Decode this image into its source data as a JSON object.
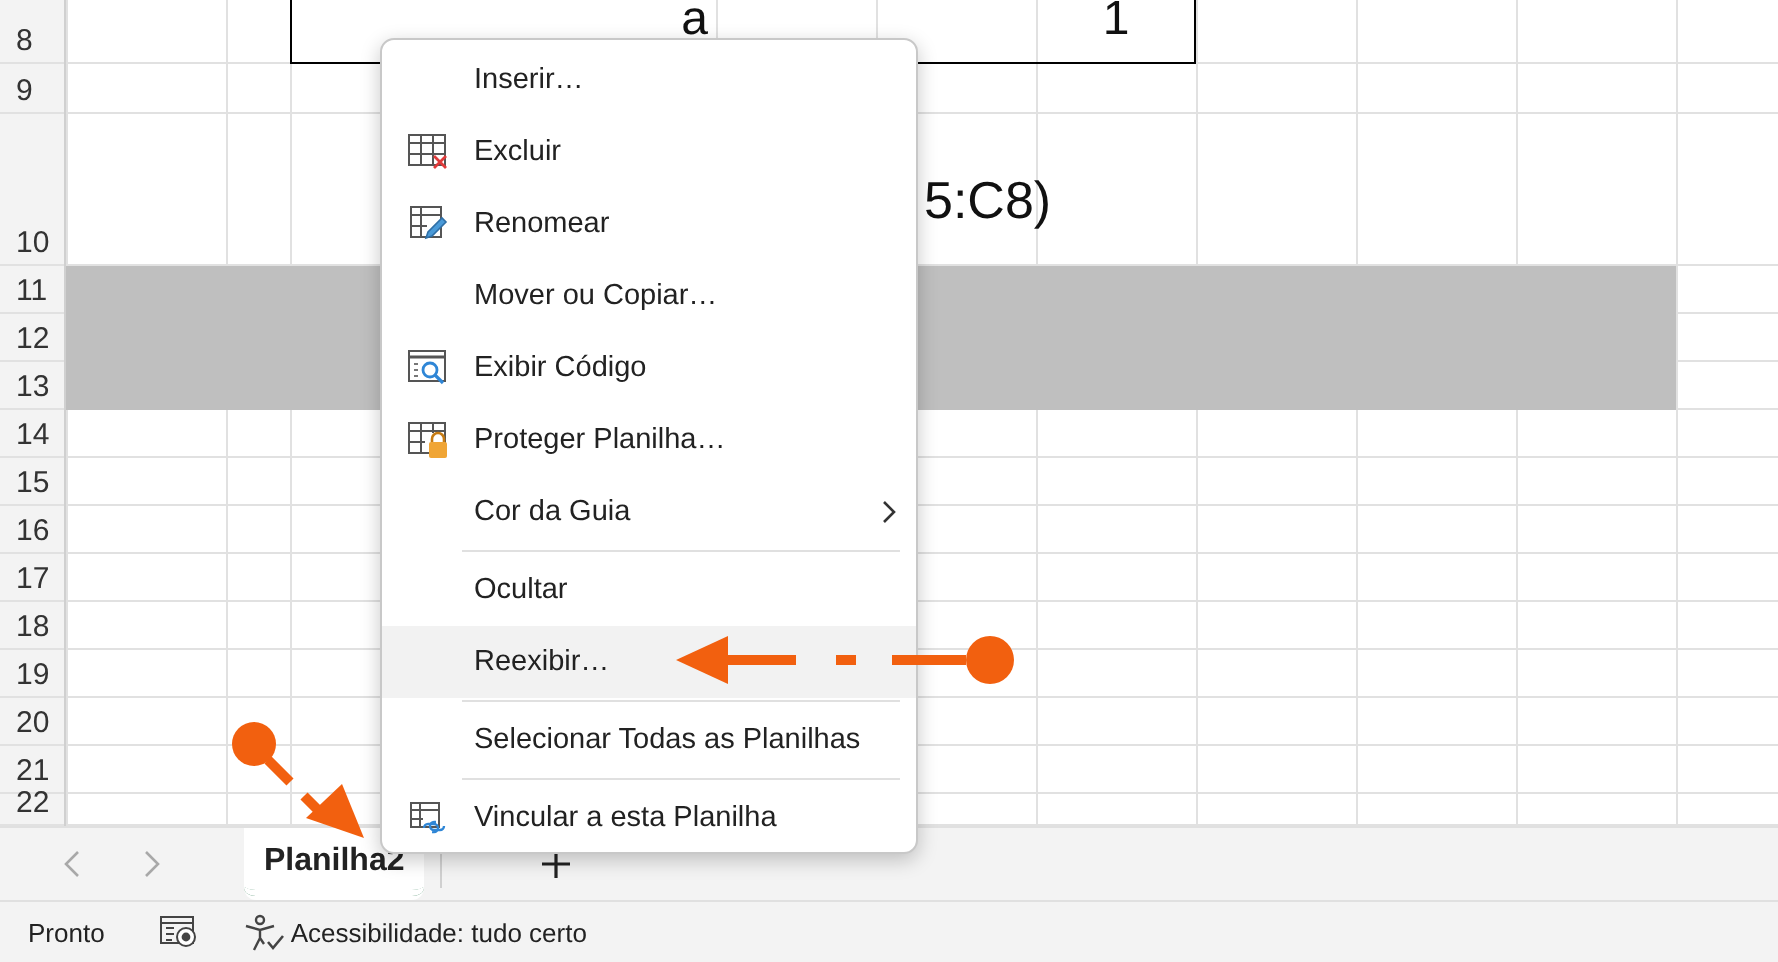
{
  "sheet": {
    "rows": [
      {
        "header": "8",
        "boxed": true,
        "shaded": false,
        "cells": {
          "column_3": "a",
          "column_6": "1"
        }
      },
      {
        "header": "9",
        "boxed": false,
        "shaded": false
      },
      {
        "header": "10",
        "boxed": false,
        "shaded": false,
        "cells": {
          "column_5": "5:C8)"
        }
      },
      {
        "header": "11",
        "boxed": false,
        "shaded": true
      },
      {
        "header": "12",
        "boxed": false,
        "shaded": true
      },
      {
        "header": "13",
        "boxed": false,
        "shaded": true
      },
      {
        "header": "14",
        "boxed": false,
        "shaded": false
      },
      {
        "header": "15",
        "boxed": false,
        "shaded": false
      },
      {
        "header": "16",
        "boxed": false,
        "shaded": false
      },
      {
        "header": "17",
        "boxed": false,
        "shaded": false
      },
      {
        "header": "18",
        "boxed": false,
        "shaded": false
      },
      {
        "header": "19",
        "boxed": false,
        "shaded": false
      },
      {
        "header": "20",
        "boxed": false,
        "shaded": false
      },
      {
        "header": "21",
        "boxed": false,
        "shaded": false
      },
      {
        "header": "22",
        "boxed": false,
        "shaded": false
      }
    ]
  },
  "context_menu": {
    "groups": [
      [
        {
          "label": "Inserir…",
          "highlighted": false,
          "submenu": false
        },
        {
          "label": "Excluir",
          "highlighted": false,
          "submenu": false
        },
        {
          "label": "Renomear",
          "highlighted": false,
          "submenu": false
        },
        {
          "label": "Mover ou Copiar…",
          "highlighted": false,
          "submenu": false
        },
        {
          "label": "Exibir Código",
          "highlighted": false,
          "submenu": false
        },
        {
          "label": "Proteger Planilha…",
          "highlighted": false,
          "submenu": false
        },
        {
          "label": "Cor da Guia",
          "highlighted": false,
          "submenu": true
        }
      ],
      [
        {
          "label": "Ocultar",
          "highlighted": false,
          "submenu": false
        },
        {
          "label": "Reexibir…",
          "highlighted": true,
          "submenu": false
        }
      ],
      [
        {
          "label": "Selecionar Todas as Planilhas",
          "highlighted": false,
          "submenu": false
        }
      ],
      [
        {
          "label": "Vincular a esta Planilha",
          "highlighted": false,
          "submenu": false
        }
      ]
    ]
  },
  "sheet_tabs": [
    {
      "label": "Planilha2",
      "selected": true
    }
  ],
  "status_bar": {
    "status": "Pronto",
    "accessibility": "Acessibilidade: tudo certo"
  }
}
